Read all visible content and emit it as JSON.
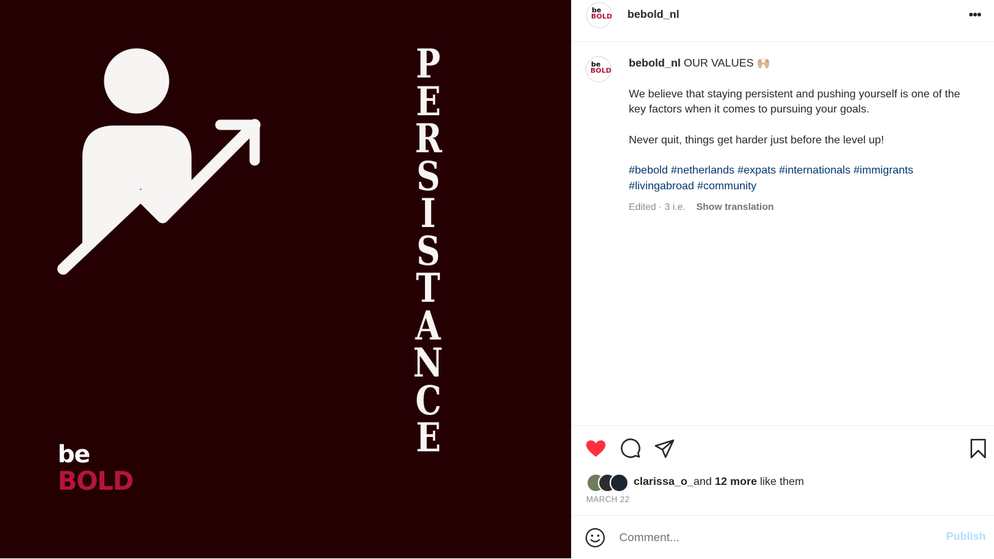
{
  "image": {
    "vertical_word_letters": [
      "P",
      "E",
      "R",
      "S",
      "I",
      "S",
      "T",
      "A",
      "N",
      "C",
      "E"
    ],
    "brand_be": "be",
    "brand_bold": "BOLD",
    "background_color": "#240003",
    "icon": "person-growth-arrow-icon"
  },
  "header": {
    "avatar_be": "be",
    "avatar_bold": "BOLD",
    "username": "bebold_nl",
    "more_icon": "more-options-icon"
  },
  "caption": {
    "avatar_be": "be",
    "avatar_bold": "BOLD",
    "username": "bebold_nl",
    "title": "OUR VALUES",
    "emoji": "🙌🏼",
    "paragraph1": "We believe that staying persistent and pushing yourself is one of the key factors when it comes to pursuing your goals.",
    "paragraph2": "Never quit, things get harder just before the level up!",
    "hashtags": [
      "#bebold",
      "#netherlands",
      "#expats",
      "#internationals",
      "#immigrants",
      "#livingabroad",
      "#community"
    ],
    "edited": "Edited",
    "age": "· 3 i.e.",
    "show_translation": "Show translation"
  },
  "actions": {
    "like_icon": "heart-filled-icon",
    "comment_icon": "comment-icon",
    "share_icon": "share-icon",
    "save_icon": "bookmark-icon",
    "like_color": "#ff3040"
  },
  "likes": {
    "first_user": "clarissa_o_",
    "and": "and",
    "more": "12 more",
    "suffix": "like them"
  },
  "date": "MARCH 22",
  "comment": {
    "emoji_icon": "emoji-smiley-icon",
    "placeholder": "Comment...",
    "publish": "Publish"
  }
}
